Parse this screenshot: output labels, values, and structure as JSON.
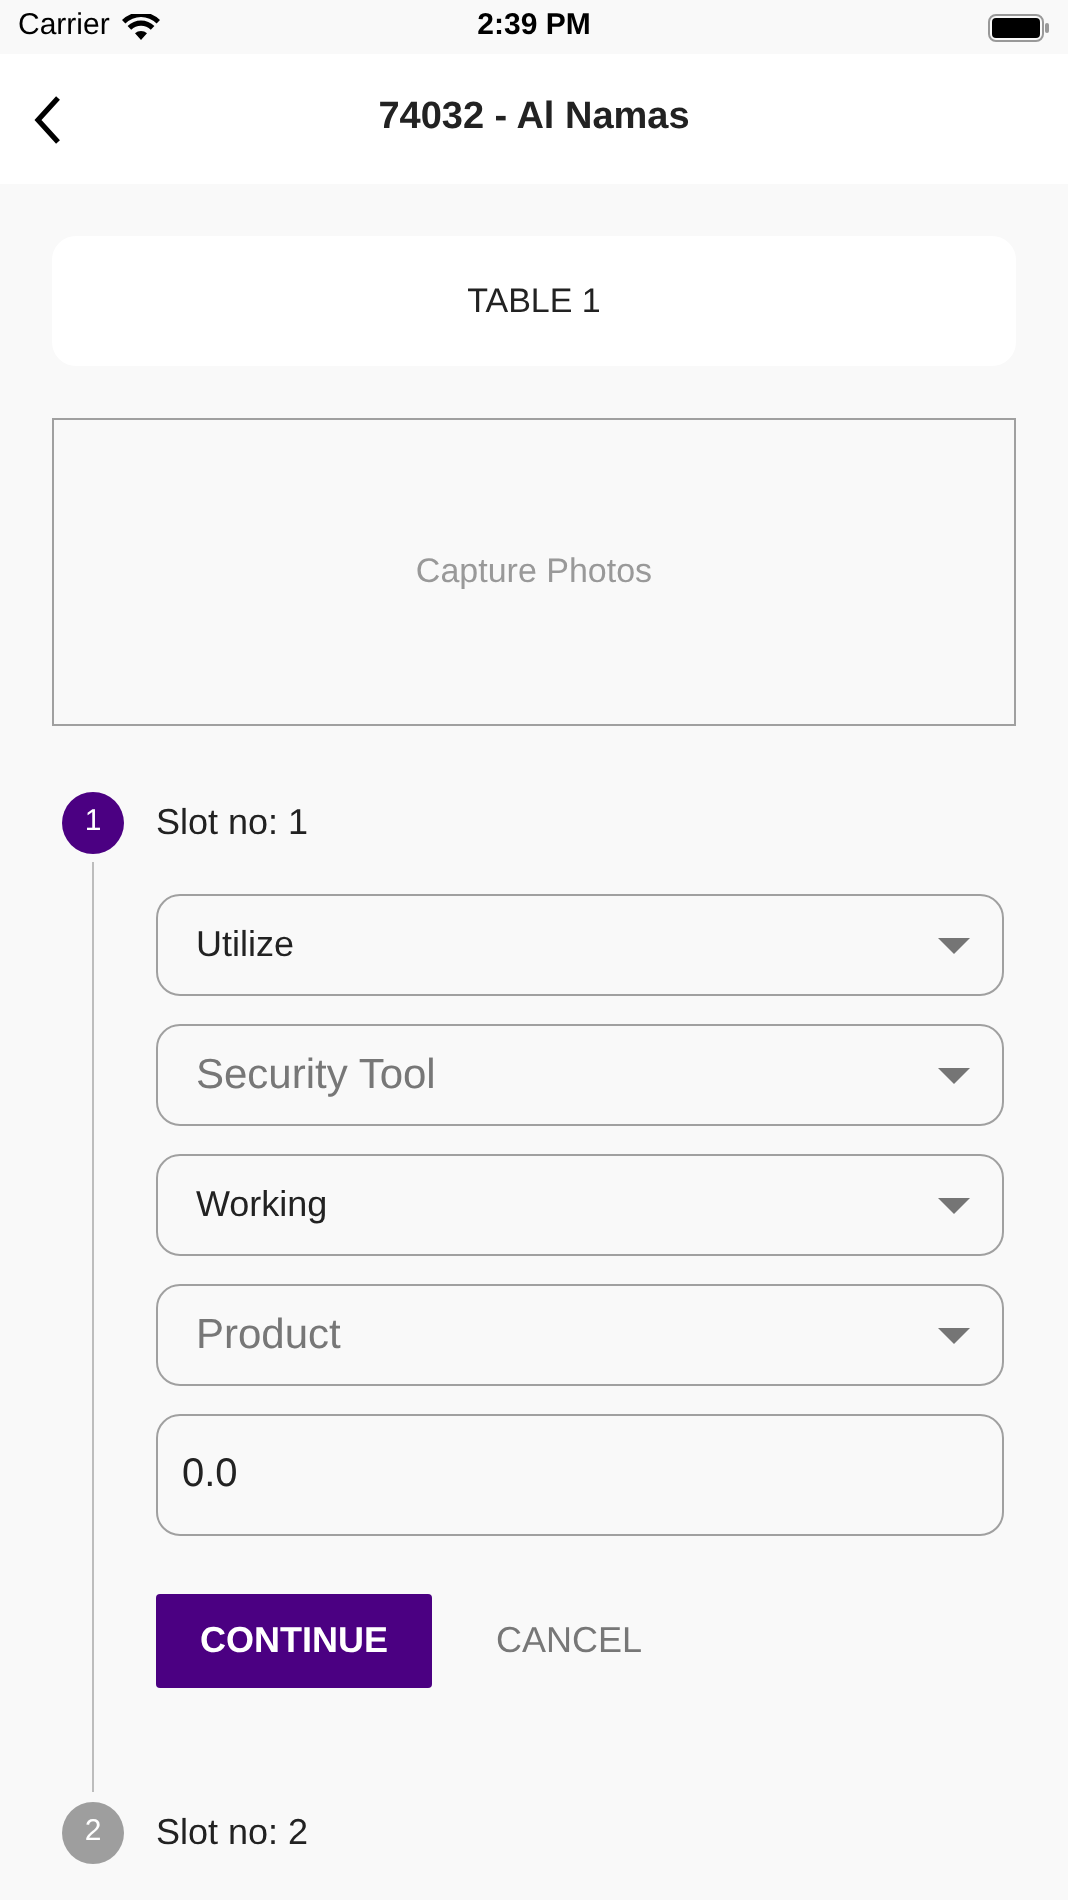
{
  "status_bar": {
    "carrier": "Carrier",
    "time": "2:39 PM"
  },
  "nav": {
    "title": "74032 - Al Namas"
  },
  "table_card": {
    "label": "TABLE 1"
  },
  "capture": {
    "label": "Capture Photos"
  },
  "steps": [
    {
      "number": "1",
      "title": "Slot no: 1",
      "active": true,
      "dropdowns": [
        {
          "value": "Utilize"
        },
        {
          "placeholder": "Security Tool"
        },
        {
          "value": "Working"
        },
        {
          "placeholder": "Product"
        }
      ],
      "input": {
        "value": "0.0"
      },
      "buttons": {
        "continue": "CONTINUE",
        "cancel": "CANCEL"
      }
    },
    {
      "number": "2",
      "title": "Slot no: 2",
      "active": false
    }
  ]
}
